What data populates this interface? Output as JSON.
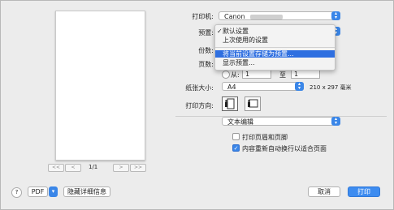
{
  "preview": {
    "page_indicator": "1/1",
    "first_label": "<<",
    "prev_label": "<",
    "next_label": ">",
    "last_label": ">>"
  },
  "form": {
    "printer_label": "打印机:",
    "printer_value": "Canon",
    "presets_label": "预置:",
    "copies_label": "份数:",
    "pages_label": "页数:",
    "from_label": "从:",
    "from_value": "1",
    "to_label": "至",
    "to_value": "1",
    "paper_size_label": "纸张大小:",
    "paper_size_value": "A4",
    "paper_dimensions": "210 x 297 毫米",
    "orientation_label": "打印方向:",
    "section_value": "文本编辑",
    "option1_label": "打印页眉和页脚",
    "option1_checked": false,
    "option2_label": "内容重新自动换行以适合页面",
    "option2_checked": true
  },
  "presets_menu": {
    "items": [
      {
        "label": "默认设置",
        "checked": true
      },
      {
        "label": "上次使用的设置",
        "checked": false
      },
      {
        "label": "将当前设置存储为预置...",
        "highlighted": true
      },
      {
        "label": "显示预置...",
        "checked": false
      }
    ]
  },
  "footer": {
    "help_label": "?",
    "pdf_label": "PDF",
    "hide_details_label": "隐藏详细信息",
    "cancel_label": "取消",
    "print_label": "打印"
  },
  "colors": {
    "accent": "#3a86e8",
    "menu_highlight": "#2f6fe0"
  }
}
